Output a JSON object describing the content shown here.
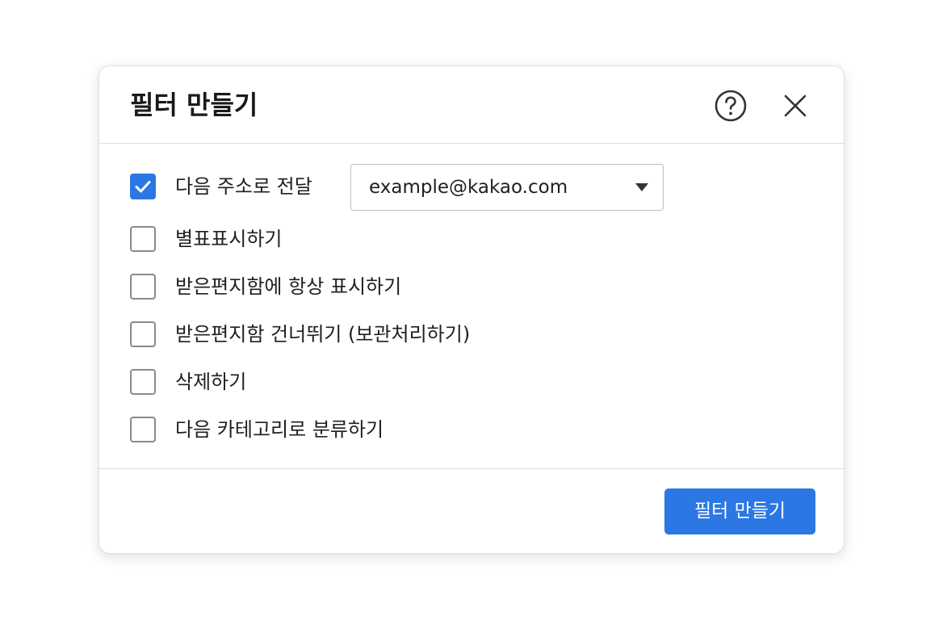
{
  "dialog": {
    "title": "필터 만들기",
    "help_icon": "help-circle-icon",
    "close_icon": "close-icon"
  },
  "options": [
    {
      "label": "다음 주소로 전달",
      "checked": true
    },
    {
      "label": "별표표시하기",
      "checked": false
    },
    {
      "label": "받은편지함에 항상 표시하기",
      "checked": false
    },
    {
      "label": "받은편지함 건너뛰기 (보관처리하기)",
      "checked": false
    },
    {
      "label": "삭제하기",
      "checked": false
    },
    {
      "label": "다음 카테고리로 분류하기",
      "checked": false
    }
  ],
  "forward_select": {
    "value": "example@kakao.com",
    "caret_icon": "caret-down-icon"
  },
  "footer": {
    "submit_label": "필터 만들기"
  },
  "colors": {
    "accent": "#2b78e4",
    "checkbox_border": "#8a8a8a",
    "divider": "#dcdcdc"
  }
}
